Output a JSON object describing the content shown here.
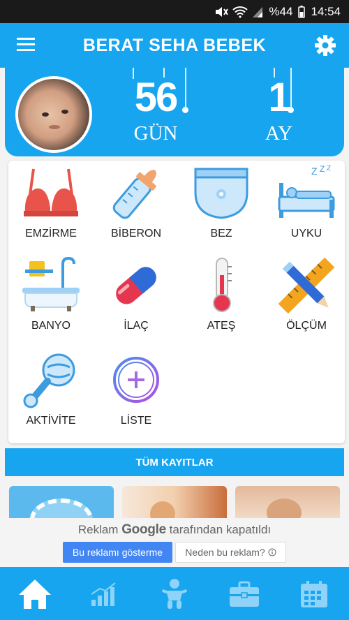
{
  "statusbar": {
    "battery": "%44",
    "time": "14:54"
  },
  "appbar": {
    "title": "BERAT SEHA BEBEK",
    "menu_icon": "hamburger-menu-icon",
    "settings_icon": "gear-icon"
  },
  "header": {
    "days_value": "56",
    "days_unit": "GÜN",
    "months_value": "1",
    "months_unit": "AY"
  },
  "activities": [
    {
      "label": "EMZİRME",
      "icon": "bra-icon"
    },
    {
      "label": "BİBERON",
      "icon": "baby-bottle-icon"
    },
    {
      "label": "BEZ",
      "icon": "diaper-icon"
    },
    {
      "label": "UYKU",
      "icon": "bed-sleep-icon"
    },
    {
      "label": "BANYO",
      "icon": "bathtub-icon"
    },
    {
      "label": "İLAÇ",
      "icon": "pill-icon"
    },
    {
      "label": "ATEŞ",
      "icon": "thermometer-icon"
    },
    {
      "label": "ÖLÇÜM",
      "icon": "ruler-pencil-icon"
    },
    {
      "label": "AKTİVİTE",
      "icon": "rattle-icon"
    },
    {
      "label": "LİSTE",
      "icon": "add-circle-icon"
    }
  ],
  "all_records_label": "TÜM KAYITLAR",
  "ad": {
    "text_before": "Reklam",
    "brand": "Google",
    "text_after": "tarafından kapatıldı",
    "stop_button": "Bu reklamı gösterme",
    "why_button": "Neden bu reklam?"
  },
  "bottom_nav": [
    {
      "icon": "home-icon",
      "active": true
    },
    {
      "icon": "chart-icon",
      "active": false
    },
    {
      "icon": "baby-icon",
      "active": false
    },
    {
      "icon": "briefcase-icon",
      "active": false
    },
    {
      "icon": "calendar-icon",
      "active": false
    }
  ],
  "colors": {
    "primary": "#17a5ef",
    "statusbar": "#1a1a1a",
    "ad_button": "#4286f4"
  }
}
